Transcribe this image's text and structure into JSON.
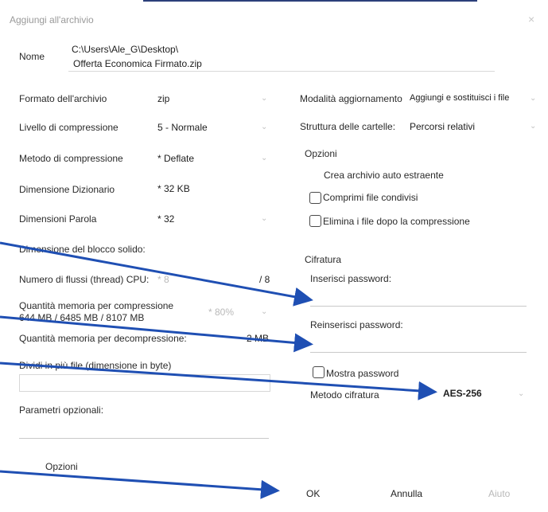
{
  "window": {
    "title": "Aggiungi all'archivio",
    "close_glyph": "×"
  },
  "name": {
    "label": "Nome",
    "path": "C:\\Users\\Ale_G\\Desktop\\",
    "filename": "Offerta Economica Firmato.zip"
  },
  "left": {
    "format": {
      "label": "Formato dell'archivio",
      "value": "zip"
    },
    "level": {
      "label": "Livello di compressione",
      "value": "5 - Normale"
    },
    "method": {
      "label": "Metodo di compressione",
      "value": "* Deflate"
    },
    "dict": {
      "label": "Dimensione Dizionario",
      "value": "* 32 KB"
    },
    "word": {
      "label": "Dimensioni Parola",
      "value": "* 32"
    },
    "solid": {
      "label": "Dimensione del blocco solido:"
    },
    "threads": {
      "label": "Numero di flussi (thread) CPU:",
      "value": "* 8",
      "max": "/ 8"
    },
    "mem_comp": {
      "label": "Quantità memoria per compressione",
      "detail": "644 MB / 6485 MB / 8107 MB",
      "value": "* 80%"
    },
    "mem_decomp": {
      "label": "Quantità memoria per decompressione:",
      "value": "2 MB"
    },
    "split": {
      "label": "Dividi in più file (dimensione in byte)"
    },
    "params": {
      "label": "Parametri opzionali:"
    },
    "options_button": "Opzioni"
  },
  "right": {
    "update": {
      "label": "Modalità aggiornamento",
      "value": "Aggiungi e sostituisci i file"
    },
    "folders": {
      "label": "Struttura delle cartelle:",
      "value": "Percorsi relativi"
    },
    "options": {
      "header": "Opzioni",
      "sfx": "Crea archivio auto estraente",
      "shared": "Comprimi file condivisi",
      "delete_after": "Elimina i file dopo la compressione"
    },
    "encryption": {
      "header": "Cifratura",
      "password_label": "Inserisci password:",
      "repeat_label": "Reinserisci password:",
      "show_password": "Mostra password",
      "method_label": "Metodo cifratura",
      "method_value": "AES-256"
    }
  },
  "buttons": {
    "ok": "OK",
    "cancel": "Annulla",
    "help": "Aiuto"
  },
  "colors": {
    "annotation_arrow": "#1f4fb3",
    "accent": "#2b3f7a"
  }
}
